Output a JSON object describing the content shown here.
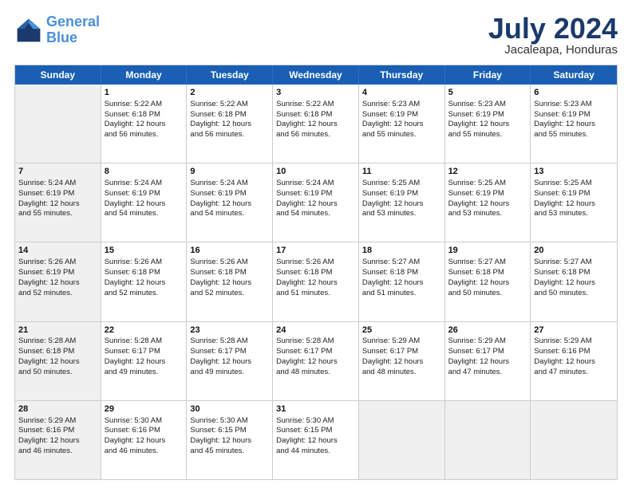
{
  "header": {
    "logo_line1": "General",
    "logo_line2": "Blue",
    "main_title": "July 2024",
    "subtitle": "Jacaleapa, Honduras"
  },
  "days_of_week": [
    "Sunday",
    "Monday",
    "Tuesday",
    "Wednesday",
    "Thursday",
    "Friday",
    "Saturday"
  ],
  "weeks": [
    [
      {
        "date": "",
        "info": "",
        "shaded": true
      },
      {
        "date": "1",
        "info": "Sunrise: 5:22 AM\nSunset: 6:18 PM\nDaylight: 12 hours\nand 56 minutes.",
        "shaded": false
      },
      {
        "date": "2",
        "info": "Sunrise: 5:22 AM\nSunset: 6:18 PM\nDaylight: 12 hours\nand 56 minutes.",
        "shaded": false
      },
      {
        "date": "3",
        "info": "Sunrise: 5:22 AM\nSunset: 6:18 PM\nDaylight: 12 hours\nand 56 minutes.",
        "shaded": false
      },
      {
        "date": "4",
        "info": "Sunrise: 5:23 AM\nSunset: 6:19 PM\nDaylight: 12 hours\nand 55 minutes.",
        "shaded": false
      },
      {
        "date": "5",
        "info": "Sunrise: 5:23 AM\nSunset: 6:19 PM\nDaylight: 12 hours\nand 55 minutes.",
        "shaded": false
      },
      {
        "date": "6",
        "info": "Sunrise: 5:23 AM\nSunset: 6:19 PM\nDaylight: 12 hours\nand 55 minutes.",
        "shaded": false
      }
    ],
    [
      {
        "date": "7",
        "info": "Sunrise: 5:24 AM\nSunset: 6:19 PM\nDaylight: 12 hours\nand 55 minutes.",
        "shaded": true
      },
      {
        "date": "8",
        "info": "Sunrise: 5:24 AM\nSunset: 6:19 PM\nDaylight: 12 hours\nand 54 minutes.",
        "shaded": false
      },
      {
        "date": "9",
        "info": "Sunrise: 5:24 AM\nSunset: 6:19 PM\nDaylight: 12 hours\nand 54 minutes.",
        "shaded": false
      },
      {
        "date": "10",
        "info": "Sunrise: 5:24 AM\nSunset: 6:19 PM\nDaylight: 12 hours\nand 54 minutes.",
        "shaded": false
      },
      {
        "date": "11",
        "info": "Sunrise: 5:25 AM\nSunset: 6:19 PM\nDaylight: 12 hours\nand 53 minutes.",
        "shaded": false
      },
      {
        "date": "12",
        "info": "Sunrise: 5:25 AM\nSunset: 6:19 PM\nDaylight: 12 hours\nand 53 minutes.",
        "shaded": false
      },
      {
        "date": "13",
        "info": "Sunrise: 5:25 AM\nSunset: 6:19 PM\nDaylight: 12 hours\nand 53 minutes.",
        "shaded": false
      }
    ],
    [
      {
        "date": "14",
        "info": "Sunrise: 5:26 AM\nSunset: 6:19 PM\nDaylight: 12 hours\nand 52 minutes.",
        "shaded": true
      },
      {
        "date": "15",
        "info": "Sunrise: 5:26 AM\nSunset: 6:18 PM\nDaylight: 12 hours\nand 52 minutes.",
        "shaded": false
      },
      {
        "date": "16",
        "info": "Sunrise: 5:26 AM\nSunset: 6:18 PM\nDaylight: 12 hours\nand 52 minutes.",
        "shaded": false
      },
      {
        "date": "17",
        "info": "Sunrise: 5:26 AM\nSunset: 6:18 PM\nDaylight: 12 hours\nand 51 minutes.",
        "shaded": false
      },
      {
        "date": "18",
        "info": "Sunrise: 5:27 AM\nSunset: 6:18 PM\nDaylight: 12 hours\nand 51 minutes.",
        "shaded": false
      },
      {
        "date": "19",
        "info": "Sunrise: 5:27 AM\nSunset: 6:18 PM\nDaylight: 12 hours\nand 50 minutes.",
        "shaded": false
      },
      {
        "date": "20",
        "info": "Sunrise: 5:27 AM\nSunset: 6:18 PM\nDaylight: 12 hours\nand 50 minutes.",
        "shaded": false
      }
    ],
    [
      {
        "date": "21",
        "info": "Sunrise: 5:28 AM\nSunset: 6:18 PM\nDaylight: 12 hours\nand 50 minutes.",
        "shaded": true
      },
      {
        "date": "22",
        "info": "Sunrise: 5:28 AM\nSunset: 6:17 PM\nDaylight: 12 hours\nand 49 minutes.",
        "shaded": false
      },
      {
        "date": "23",
        "info": "Sunrise: 5:28 AM\nSunset: 6:17 PM\nDaylight: 12 hours\nand 49 minutes.",
        "shaded": false
      },
      {
        "date": "24",
        "info": "Sunrise: 5:28 AM\nSunset: 6:17 PM\nDaylight: 12 hours\nand 48 minutes.",
        "shaded": false
      },
      {
        "date": "25",
        "info": "Sunrise: 5:29 AM\nSunset: 6:17 PM\nDaylight: 12 hours\nand 48 minutes.",
        "shaded": false
      },
      {
        "date": "26",
        "info": "Sunrise: 5:29 AM\nSunset: 6:17 PM\nDaylight: 12 hours\nand 47 minutes.",
        "shaded": false
      },
      {
        "date": "27",
        "info": "Sunrise: 5:29 AM\nSunset: 6:16 PM\nDaylight: 12 hours\nand 47 minutes.",
        "shaded": false
      }
    ],
    [
      {
        "date": "28",
        "info": "Sunrise: 5:29 AM\nSunset: 6:16 PM\nDaylight: 12 hours\nand 46 minutes.",
        "shaded": true
      },
      {
        "date": "29",
        "info": "Sunrise: 5:30 AM\nSunset: 6:16 PM\nDaylight: 12 hours\nand 46 minutes.",
        "shaded": false
      },
      {
        "date": "30",
        "info": "Sunrise: 5:30 AM\nSunset: 6:15 PM\nDaylight: 12 hours\nand 45 minutes.",
        "shaded": false
      },
      {
        "date": "31",
        "info": "Sunrise: 5:30 AM\nSunset: 6:15 PM\nDaylight: 12 hours\nand 44 minutes.",
        "shaded": false
      },
      {
        "date": "",
        "info": "",
        "shaded": true
      },
      {
        "date": "",
        "info": "",
        "shaded": true
      },
      {
        "date": "",
        "info": "",
        "shaded": true
      }
    ]
  ]
}
